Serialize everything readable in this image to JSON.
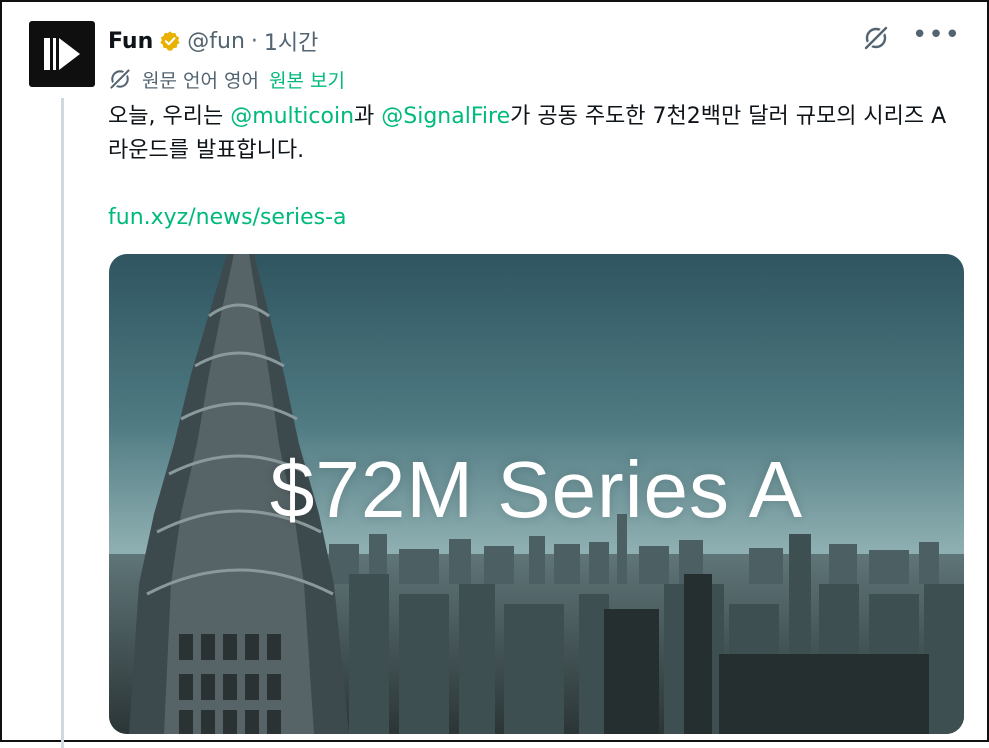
{
  "author": {
    "name": "Fun",
    "handle": "@fun",
    "separator": "·",
    "time": "1시간"
  },
  "icons": {
    "verified": "verified-badge-icon",
    "grok": "grok-icon",
    "more": "more-icon",
    "translate": "translate-icon",
    "avatar": "fun-logo"
  },
  "translation": {
    "label": "원문 언어 영어",
    "link": "원본 보기"
  },
  "tweet": {
    "text_part1": "오늘, 우리는 ",
    "mention1": "@multicoin",
    "text_part2": "과 ",
    "mention2": "@SignalFire",
    "text_part3": "가 공동 주도한 7천2백만 달러 규모의 시리즈 A 라운드를 발표합니다.",
    "link": "fun.xyz/news/series-a"
  },
  "media": {
    "headline": "$72M Series A"
  },
  "colors": {
    "accent": "#00ba7c",
    "secondary_text": "#536471",
    "verified_gold": "#e8b100"
  }
}
